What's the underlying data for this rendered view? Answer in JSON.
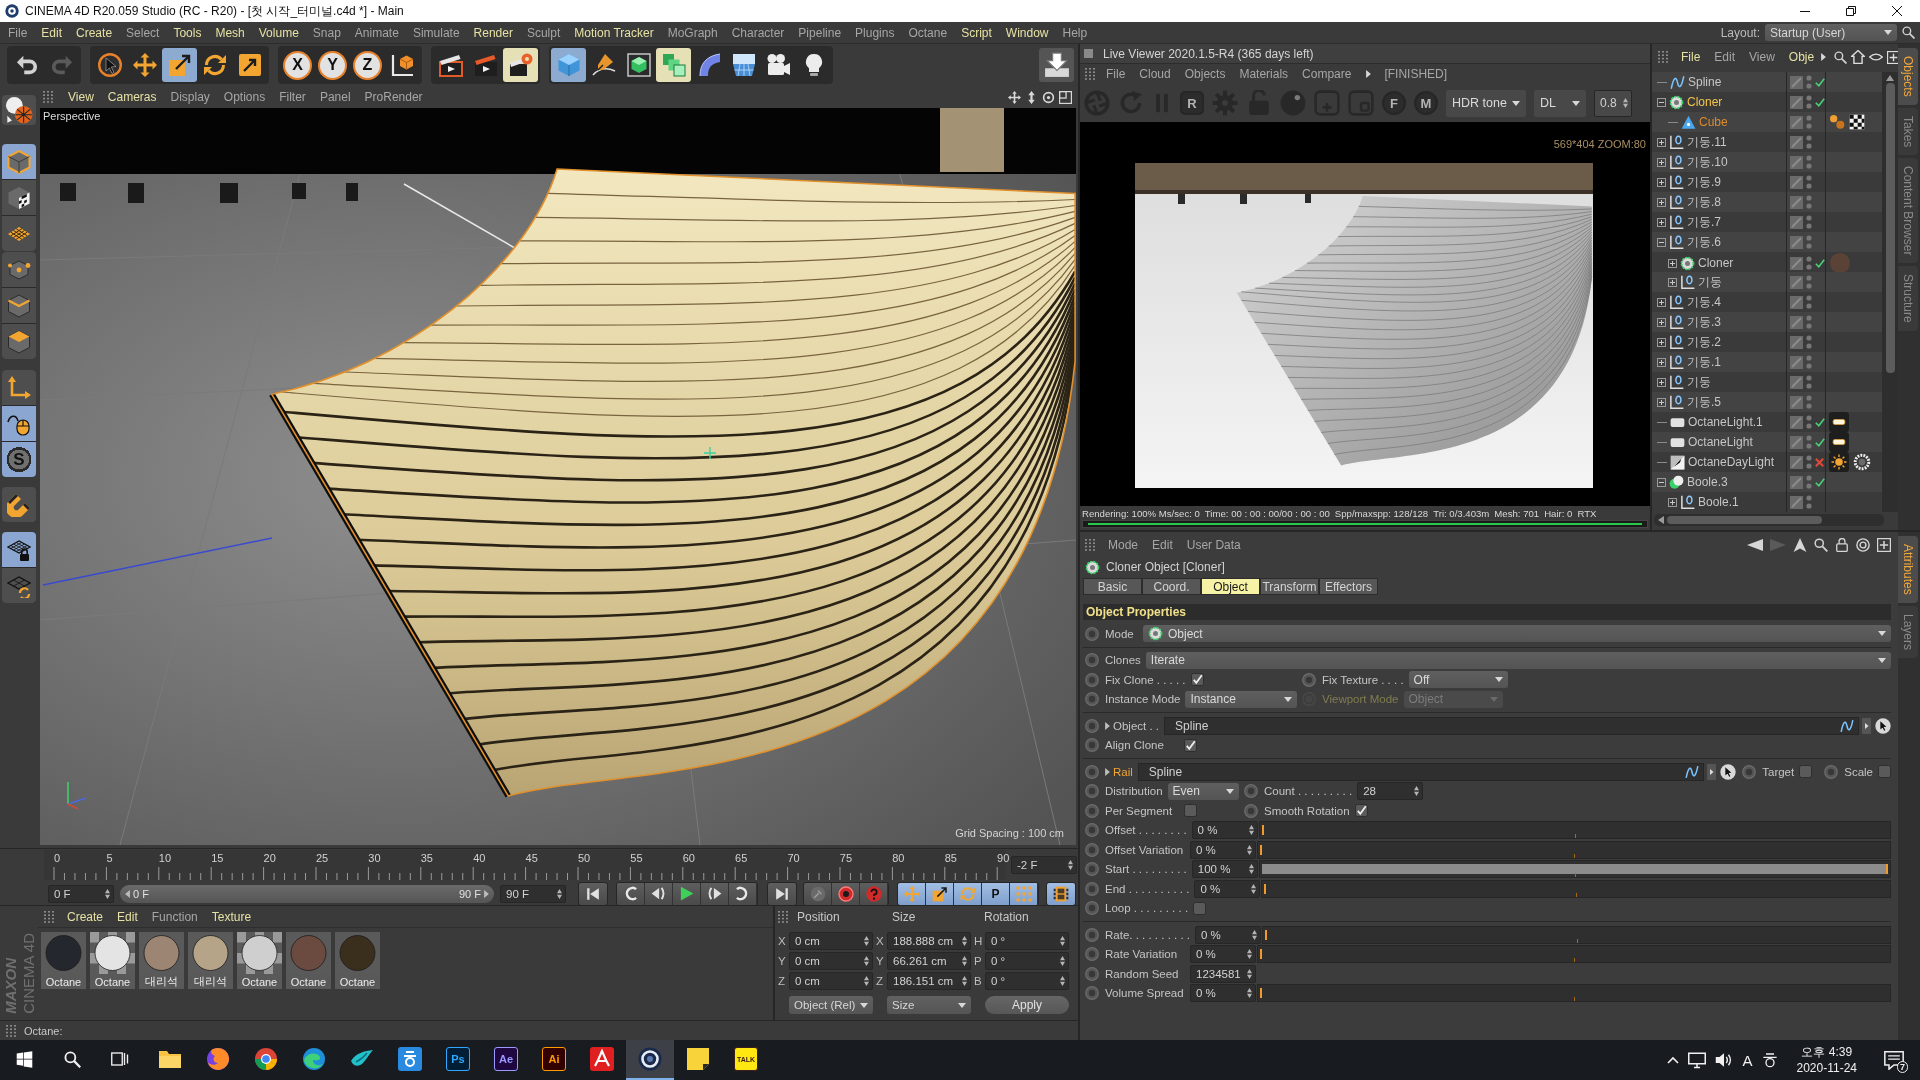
{
  "window": {
    "title": "CINEMA 4D R20.059 Studio (RC - R20) - [첫 시작_터미널.c4d *] - Main"
  },
  "menu_bar": {
    "items": [
      {
        "label": "File",
        "highlighted": false
      },
      {
        "label": "Edit",
        "highlighted": true
      },
      {
        "label": "Create",
        "highlighted": true
      },
      {
        "label": "Select",
        "highlighted": false
      },
      {
        "label": "Tools",
        "highlighted": true
      },
      {
        "label": "Mesh",
        "highlighted": true
      },
      {
        "label": "Volume",
        "highlighted": true
      },
      {
        "label": "Snap",
        "highlighted": false
      },
      {
        "label": "Animate",
        "highlighted": false
      },
      {
        "label": "Simulate",
        "highlighted": false
      },
      {
        "label": "Render",
        "highlighted": true
      },
      {
        "label": "Sculpt",
        "highlighted": false
      },
      {
        "label": "Motion Tracker",
        "highlighted": true
      },
      {
        "label": "MoGraph",
        "highlighted": false
      },
      {
        "label": "Character",
        "highlighted": false
      },
      {
        "label": "Pipeline",
        "highlighted": false
      },
      {
        "label": "Plugins",
        "highlighted": false
      },
      {
        "label": "Octane",
        "highlighted": false
      },
      {
        "label": "Script",
        "highlighted": true
      },
      {
        "label": "Window",
        "highlighted": true
      },
      {
        "label": "Help",
        "highlighted": false
      }
    ],
    "layout_label": "Layout:",
    "layout_value": "Startup (User)"
  },
  "toolbar": {
    "groups": [
      [
        {
          "selected": false,
          "highlighted": false
        },
        {
          "selected": false,
          "highlighted": false
        }
      ],
      [
        {
          "selected": false,
          "highlighted": false
        },
        {
          "selected": false,
          "highlighted": false
        },
        {
          "selected": true,
          "highlighted": false
        },
        {
          "selected": false,
          "highlighted": false
        },
        {
          "selected": false,
          "highlighted": false
        }
      ],
      [
        {
          "label": "X",
          "selected": false,
          "highlighted": false
        },
        {
          "label": "Y",
          "selected": false,
          "highlighted": false
        },
        {
          "label": "Z",
          "selected": false,
          "highlighted": false
        },
        {
          "selected": false,
          "highlighted": false
        }
      ],
      [
        {
          "selected": false,
          "highlighted": false
        },
        {
          "selected": false,
          "highlighted": false
        },
        {
          "selected": false,
          "highlighted": true
        }
      ],
      [
        {
          "selected": true,
          "highlighted": false
        },
        {
          "selected": false,
          "highlighted": false
        },
        {
          "selected": false,
          "highlighted": false
        },
        {
          "selected": false,
          "highlighted": true
        },
        {
          "selected": false,
          "highlighted": false
        },
        {
          "selected": false,
          "highlighted": false
        },
        {
          "selected": false,
          "highlighted": false
        },
        {
          "selected": false,
          "highlighted": false
        }
      ]
    ],
    "render_button": {
      "selected": false
    }
  },
  "tool_column": [
    {
      "selected": false
    },
    {
      "selected": true
    },
    {
      "selected": false
    },
    {
      "selected": false
    },
    {
      "selected": false
    },
    {
      "selected": false
    },
    {
      "selected": false
    },
    {
      "selected": false
    },
    {
      "selected": true
    },
    {
      "label": "S",
      "selected": true
    },
    {
      "selected": false
    },
    {
      "selected": true
    },
    {
      "selected": false
    }
  ],
  "viewport": {
    "menu": [
      {
        "label": "View",
        "highlighted": true
      },
      {
        "label": "Cameras",
        "highlighted": true
      },
      {
        "label": "Display",
        "highlighted": false
      },
      {
        "label": "Options",
        "highlighted": false
      },
      {
        "label": "Filter",
        "highlighted": false
      },
      {
        "label": "Panel",
        "highlighted": false
      },
      {
        "label": "ProRender",
        "highlighted": false
      }
    ],
    "camera": "Perspective",
    "grid_spacing": "Grid Spacing : 100 cm"
  },
  "timeline": {
    "frame_labels": [
      "0",
      "5",
      "10",
      "15",
      "20",
      "25",
      "30",
      "35",
      "40",
      "45",
      "50",
      "55",
      "60",
      "65",
      "70",
      "75",
      "80",
      "85",
      "90"
    ],
    "current_frame": "-2 F",
    "start_frame": "0 F",
    "range_start": "0 F",
    "range_end": "90 F",
    "end_frame": "90 F",
    "key_filters": [
      {
        "selected": true
      },
      {
        "selected": true
      },
      {
        "selected": true
      },
      {
        "label": "P",
        "selected": true
      },
      {
        "selected": true
      }
    ],
    "view_toggle": {
      "selected": true
    }
  },
  "materials": {
    "menu": [
      {
        "label": "Create",
        "highlighted": true
      },
      {
        "label": "Edit",
        "highlighted": true
      },
      {
        "label": "Function",
        "highlighted": false
      },
      {
        "label": "Texture",
        "highlighted": true
      }
    ],
    "items": [
      {
        "label": "Octane",
        "color": "#24272e",
        "kind": "solid"
      },
      {
        "label": "Octane",
        "color": "#e4e4e4",
        "kind": "checker"
      },
      {
        "label": "대리석",
        "color": "#9c8572",
        "kind": "solid"
      },
      {
        "label": "대리석",
        "color": "#b5a487",
        "kind": "solid"
      },
      {
        "label": "Octane",
        "color": "#cfcfcf",
        "kind": "checker"
      },
      {
        "label": "Octane",
        "color": "#6b4a40",
        "kind": "solid"
      },
      {
        "label": "Octane",
        "color": "#3a2e1d",
        "kind": "solid"
      }
    ]
  },
  "coordinates": {
    "headers": [
      "Position",
      "Size",
      "Rotation"
    ],
    "rows": [
      [
        {
          "axis": "X",
          "value": "0 cm"
        },
        {
          "axis": "X",
          "value": "188.888 cm"
        },
        {
          "axis": "H",
          "value": "0 °"
        }
      ],
      [
        {
          "axis": "Y",
          "value": "0 cm"
        },
        {
          "axis": "Y",
          "value": "66.261 cm"
        },
        {
          "axis": "P",
          "value": "0 °"
        }
      ],
      [
        {
          "axis": "Z",
          "value": "0 cm"
        },
        {
          "axis": "Z",
          "value": "186.151 cm"
        },
        {
          "axis": "B",
          "value": "0 °"
        }
      ]
    ],
    "mode": "Object (Rel)",
    "size_mode": "Size",
    "apply": "Apply"
  },
  "logo": {
    "brand": "MAXON",
    "product": "CINEMA 4D"
  },
  "status_bar": {
    "text": "Octane:"
  },
  "live_viewer": {
    "title": "Live Viewer 2020.1.5-R4 (365 days left)",
    "menu": [
      "File",
      "Cloud",
      "Objects",
      "Materials",
      "Compare"
    ],
    "state": "[FINISHED]",
    "letter_tools": [
      "R",
      "F",
      "M"
    ],
    "tone": "HDR tone",
    "kernel": "DL",
    "value": "0.8",
    "overlay": "569*404 ZOOM:80",
    "stats": [
      "Rendering: 100% Ms/sec: 0",
      "Time: 00 : 00 : 00/00 : 00 : 00",
      "Spp/maxspp: 128/128",
      "Tri: 0/3.403m",
      "Mesh: 701",
      "Hair: 0",
      "RTX"
    ],
    "progress": {
      "level": 1
    }
  },
  "object_manager": {
    "menu": [
      {
        "label": "File",
        "highlighted": true
      },
      {
        "label": "Edit",
        "highlighted": false
      },
      {
        "label": "View",
        "highlighted": false
      },
      {
        "label": "Obje",
        "highlighted": true
      }
    ],
    "tree": [
      {
        "name": "Spline",
        "kind": "spline",
        "selected": false,
        "active": false,
        "enabled": true
      },
      {
        "name": "Cloner",
        "kind": "cloner",
        "selected": true,
        "active": true,
        "enabled": true,
        "expanded": true,
        "children": [
          {
            "name": "Cube",
            "kind": "primitive",
            "selected": true,
            "active": false,
            "tags": [
              {
                "kind": "spheres"
              },
              {
                "kind": "checker"
              }
            ]
          }
        ]
      },
      {
        "name": "기둥.11",
        "kind": "null",
        "selected": false,
        "active": false,
        "expanded": false
      },
      {
        "name": "기둥.10",
        "kind": "null",
        "selected": false,
        "active": false,
        "expanded": false
      },
      {
        "name": "기둥.9",
        "kind": "null",
        "selected": false,
        "active": false,
        "expanded": false
      },
      {
        "name": "기둥.8",
        "kind": "null",
        "selected": false,
        "active": false,
        "expanded": false
      },
      {
        "name": "기둥.7",
        "kind": "null",
        "selected": false,
        "active": false,
        "expanded": false
      },
      {
        "name": "기둥.6",
        "kind": "null",
        "selected": false,
        "active": false,
        "expanded": true,
        "children": [
          {
            "name": "Cloner",
            "kind": "cloner",
            "selected": false,
            "active": false,
            "enabled": true,
            "expanded": false,
            "tags": [
              {
                "kind": "material",
                "color": "#5b4237"
              }
            ]
          },
          {
            "name": "기둥",
            "kind": "null",
            "selected": false,
            "active": false,
            "expanded": false
          }
        ]
      },
      {
        "name": "기둥.4",
        "kind": "null",
        "selected": false,
        "active": false,
        "expanded": false
      },
      {
        "name": "기둥.3",
        "kind": "null",
        "selected": false,
        "active": false,
        "expanded": false
      },
      {
        "name": "기둥.2",
        "kind": "null",
        "selected": false,
        "active": false,
        "expanded": false
      },
      {
        "name": "기둥.1",
        "kind": "null",
        "selected": false,
        "active": false,
        "expanded": false
      },
      {
        "name": "기둥",
        "kind": "null",
        "selected": false,
        "active": false,
        "expanded": false
      },
      {
        "name": "기둥.5",
        "kind": "null",
        "selected": false,
        "active": false,
        "expanded": false
      },
      {
        "name": "OctaneLight.1",
        "kind": "light",
        "selected": false,
        "active": false,
        "enabled": true,
        "tags": [
          {
            "kind": "lightbar"
          }
        ]
      },
      {
        "name": "OctaneLight",
        "kind": "light",
        "selected": false,
        "active": false,
        "enabled": true,
        "tags": [
          {
            "kind": "lightbar"
          }
        ]
      },
      {
        "name": "OctaneDayLight",
        "kind": "sky",
        "selected": false,
        "active": false,
        "enabled": false,
        "tags": [
          {
            "kind": "sun"
          },
          {
            "kind": "ring"
          }
        ]
      },
      {
        "name": "Boole.3",
        "kind": "boole",
        "selected": false,
        "active": false,
        "enabled": true,
        "expanded": true,
        "children": [
          {
            "name": "Boole.1",
            "kind": "null",
            "selected": false,
            "active": false,
            "expanded": false
          }
        ]
      }
    ],
    "side_tabs": [
      {
        "label": "Objects",
        "selected": true
      },
      {
        "label": "Takes",
        "selected": false
      },
      {
        "label": "Content Browser",
        "selected": false
      },
      {
        "label": "Structure",
        "selected": false
      }
    ]
  },
  "attributes": {
    "menu": [
      "Mode",
      "Edit",
      "User Data"
    ],
    "title": "Cloner Object [Cloner]",
    "tabs": [
      {
        "label": "Basic",
        "selected": false
      },
      {
        "label": "Coord.",
        "selected": false
      },
      {
        "label": "Object",
        "selected": true
      },
      {
        "label": "Transform",
        "selected": false
      },
      {
        "label": "Effectors",
        "selected": false
      }
    ],
    "section": "Object Properties",
    "groups": [
      [
        [
          {
            "kind": "dropdown",
            "label": "Mode",
            "value": "Object",
            "with_icon": true,
            "disabled": false
          }
        ]
      ],
      [
        [
          {
            "kind": "dropdown",
            "label": "Clones",
            "value": "Iterate",
            "disabled": false
          }
        ],
        [
          {
            "kind": "checkbox",
            "label": "Fix Clone . . . . .",
            "checked": true
          },
          {
            "kind": "dropdown",
            "label": "Fix Texture . . . .",
            "value": "Off",
            "disabled": false
          }
        ],
        [
          {
            "kind": "dropdown",
            "label": "Instance Mode",
            "value": "Instance",
            "disabled": false
          },
          {
            "kind": "dropdown",
            "label": "Viewport Mode",
            "value": "Object",
            "disabled": true
          }
        ]
      ],
      [
        [
          {
            "kind": "link",
            "label": "Object . .",
            "value": "Spline",
            "expanded": false,
            "highlighted": false
          }
        ],
        [
          {
            "kind": "checkbox",
            "label": "Align Clone",
            "checked": true
          }
        ]
      ],
      [
        [
          {
            "kind": "link",
            "label": "Rail",
            "value": "Spline",
            "expanded": false,
            "highlighted": true
          },
          {
            "kind": "checkbox",
            "label": "Target",
            "checked": false
          },
          {
            "kind": "checkbox",
            "label": "Scale",
            "checked": false
          }
        ],
        [
          {
            "kind": "dropdown",
            "label": "Distribution",
            "value": "Even",
            "disabled": false
          },
          {
            "kind": "spinner",
            "label": "Count . . . . . . . . .",
            "value": "28"
          }
        ],
        [
          {
            "kind": "checkbox",
            "label": "Per Segment",
            "checked": false
          },
          {
            "kind": "checkbox",
            "label": "Smooth Rotation",
            "checked": true
          }
        ],
        [
          {
            "kind": "slider",
            "label": "Offset . . . . . . . .",
            "value": "0 %",
            "level": 0
          }
        ],
        [
          {
            "kind": "slider",
            "label": "Offset Variation",
            "value": "0 %",
            "level": 0
          }
        ],
        [
          {
            "kind": "slider",
            "label": "Start . . . . . . . . .",
            "value": "100 %",
            "level": 1
          }
        ],
        [
          {
            "kind": "slider",
            "label": "End . . . . . . . . . .",
            "value": "0 %",
            "level": 0
          }
        ],
        [
          {
            "kind": "checkbox",
            "label": "Loop . . . . . . . . .",
            "checked": false
          }
        ]
      ],
      [
        [
          {
            "kind": "slider",
            "label": "Rate. . . . . . . . . .",
            "value": "0 %",
            "level": 0
          }
        ],
        [
          {
            "kind": "slider",
            "label": "Rate Variation",
            "value": "0 %",
            "level": 0
          }
        ],
        [
          {
            "kind": "spinner",
            "label": "Random Seed",
            "value": "1234581"
          }
        ],
        [
          {
            "kind": "slider",
            "label": "Volume Spread",
            "value": "0 %",
            "level": 0
          }
        ]
      ]
    ],
    "side_tabs": [
      {
        "label": "Attributes",
        "selected": true
      },
      {
        "label": "Layers",
        "selected": false
      }
    ]
  },
  "taskbar": {
    "apps": [
      {
        "selected": false
      },
      {
        "selected": false
      },
      {
        "selected": false
      },
      {
        "selected": false
      },
      {
        "selected": false
      },
      {
        "selected": false
      },
      {
        "label": "Ps",
        "selected": false
      },
      {
        "label": "Ae",
        "selected": false
      },
      {
        "label": "Ai",
        "selected": false
      },
      {
        "selected": false
      },
      {
        "selected": true
      },
      {
        "selected": false
      },
      {
        "label": "TALK",
        "selected": false
      }
    ],
    "ime": "A",
    "time": "오후 4:39",
    "date": "2020-11-24",
    "notifications": "7"
  }
}
